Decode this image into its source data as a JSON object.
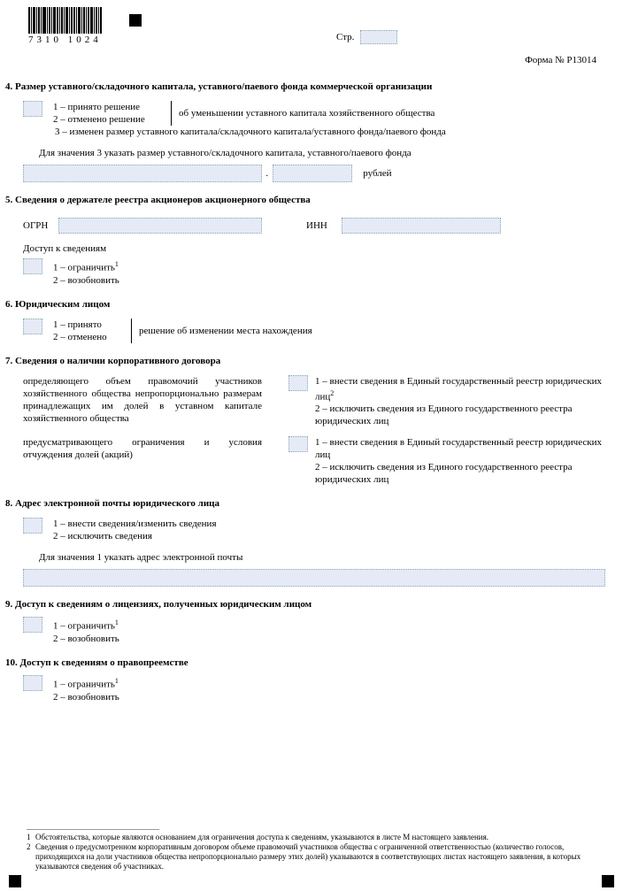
{
  "barcode_text": "7310 1024",
  "header": {
    "str_label": "Стр.",
    "form_no": "Форма № Р13014"
  },
  "s4": {
    "title": "4. Размер уставного/складочного капитала, уставного/паевого фонда коммерческой организации",
    "opt1": "1 – принято решение",
    "opt2": "2 – отменено решение",
    "side": "об уменьшении уставного капитала хозяйственного общества",
    "opt3": "3 – изменен размер уставного капитала/складочного капитала/уставного фонда/паевого фонда",
    "note": "Для значения 3 указать размер уставного/складочного капитала, уставного/паевого фонда",
    "rub": "рублей"
  },
  "s5": {
    "title": "5. Сведения о держателе реестра акционеров акционерного общества",
    "ogrn": "ОГРН",
    "inn": "ИНН",
    "access": "Доступ к сведениям",
    "opt1": "1 – ограничить",
    "opt2": "2 – возобновить"
  },
  "s6": {
    "title": "6. Юридическим лицом",
    "opt1": "1 – принято",
    "opt2": "2 – отменено",
    "side": "решение об изменении места нахождения"
  },
  "s7": {
    "title": "7. Сведения о наличии корпоративного договора",
    "leftA": "определяющего объем правомочий участников хозяйственного общества непропорционально размерам принадлежащих им долей в уставном капитале хозяйственного общества",
    "leftB": "предусматривающего ограничения и условия отчуждения долей (акций)",
    "r1a": "1 – внести сведения в Единый государственный реестр юридических лиц",
    "r1b": "2 – исключить сведения из Единого государственного реестра юридических лиц",
    "r2a": "1 – внести сведения в Единый государственный реестр юридических лиц",
    "r2b": "2 – исключить сведения из Единого государственного реестра юридических лиц"
  },
  "s8": {
    "title": "8. Адрес электронной почты юридического лица",
    "opt1": "1 – внести сведения/изменить сведения",
    "opt2": "2 – исключить сведения",
    "note": "Для значения 1 указать адрес электронной почты"
  },
  "s9": {
    "title": "9. Доступ к сведениям о лицензиях, полученных юридическим лицом",
    "opt1": "1 – ограничить",
    "opt2": "2 – возобновить"
  },
  "s10": {
    "title": "10. Доступ к сведениям о правопреемстве",
    "opt1": "1 – ограничить",
    "opt2": "2 – возобновить"
  },
  "foot": {
    "n1": "1",
    "n2": "2",
    "t1": "Обстоятельства, которые являются основанием для ограничения доступа к сведениям, указываются в листе М настоящего заявления.",
    "t2": "Сведения о предусмотренном корпоративным договором объеме правомочий участников общества с ограниченной ответственностью (количество голосов, приходящихся на доли участников общества непропорционально размеру этих долей) указываются в соответствующих листах настоящего заявления, в которых указываются сведения об участниках."
  },
  "sup1": "1",
  "sup2": "2"
}
